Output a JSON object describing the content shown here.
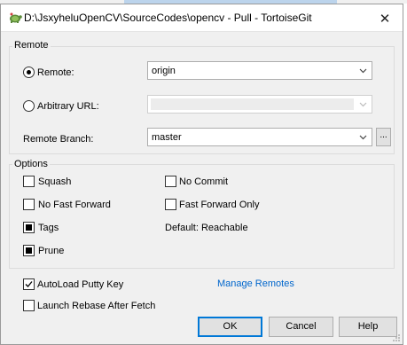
{
  "window": {
    "title": "D:\\JsxyheluOpenCV\\SourceCodes\\opencv - Pull - TortoiseGit",
    "close_glyph": "✕"
  },
  "remote_group": {
    "label": "Remote",
    "remote_radio_label": "Remote:",
    "remote_value": "origin",
    "arbitrary_url_label": "Arbitrary URL:",
    "arbitrary_url_value": "",
    "remote_branch_label": "Remote Branch:",
    "remote_branch_value": "master",
    "browse_label": "..."
  },
  "options_group": {
    "label": "Options",
    "squash": {
      "label": "Squash",
      "checked": false
    },
    "no_commit": {
      "label": "No Commit",
      "checked": false
    },
    "no_fast_forward": {
      "label": "No Fast Forward",
      "checked": false
    },
    "fast_forward_only": {
      "label": "Fast Forward Only",
      "checked": false
    },
    "tags": {
      "label": "Tags",
      "state": "indeterminate"
    },
    "default_reachable": "Default: Reachable",
    "prune": {
      "label": "Prune",
      "state": "indeterminate"
    }
  },
  "autoload_putty": {
    "label": "AutoLoad Putty Key",
    "checked": true
  },
  "manage_remotes_link": "Manage Remotes",
  "launch_rebase": {
    "label": "Launch Rebase After Fetch",
    "checked": false
  },
  "buttons": {
    "ok": "OK",
    "cancel": "Cancel",
    "help": "Help"
  },
  "colors": {
    "link": "#0066cc",
    "default_button_border": "#0078d7",
    "dialog_bg": "#f0f0f0"
  }
}
